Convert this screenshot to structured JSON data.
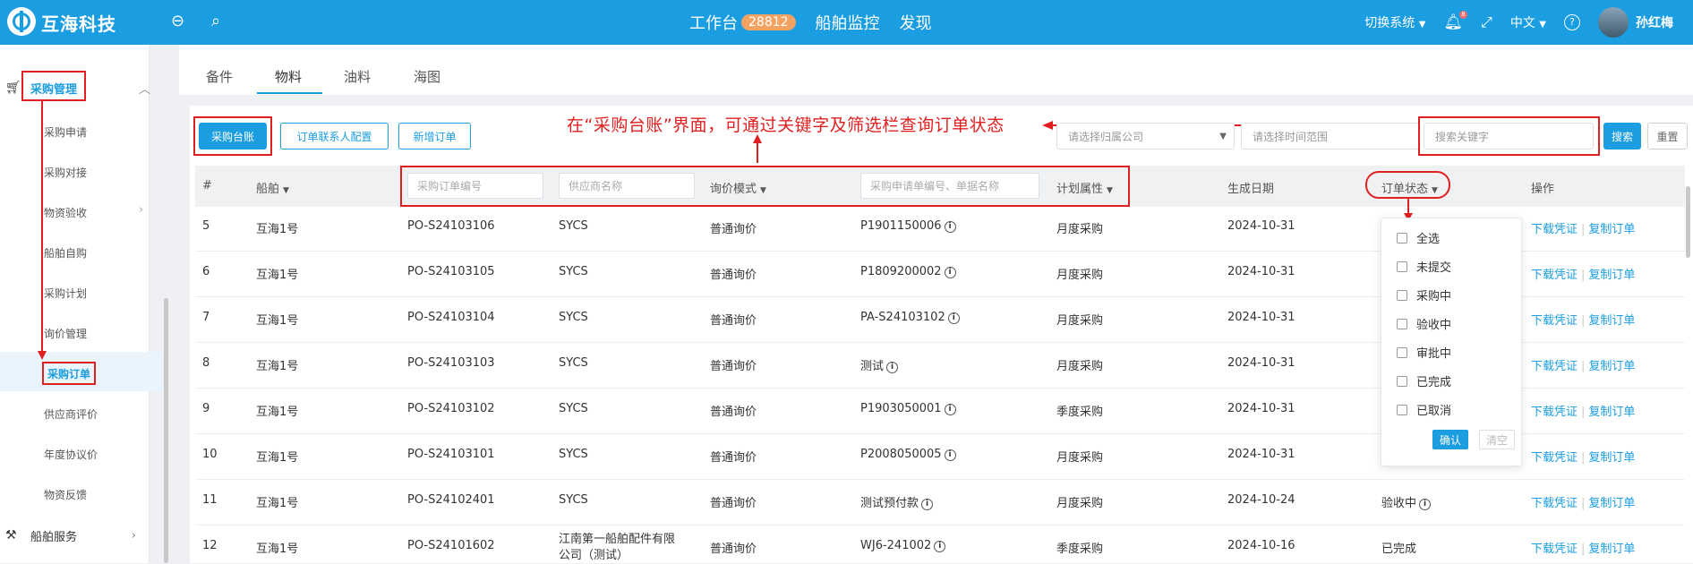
{
  "app": {
    "brand": "互海科技",
    "nav": {
      "workbench": "工作台",
      "workbench_count": "28812",
      "monitor": "船舶监控",
      "discover": "发现"
    },
    "right": {
      "switch_system": "切换系统",
      "notify_count": "8",
      "language": "中文",
      "user": "孙红梅"
    }
  },
  "sidebar": {
    "group_procurement": "采购管理",
    "items": [
      "采购申请",
      "采购对接",
      "物资验收",
      "船舶自购",
      "采购计划",
      "询价管理",
      "采购订单",
      "供应商评价",
      "年度协议价",
      "物资反馈"
    ],
    "group_service": "船舶服务"
  },
  "tabs": [
    "备件",
    "物料",
    "油料",
    "海图"
  ],
  "toolbar": {
    "ledger": "采购台账",
    "contact_config": "订单联系人配置",
    "new_order": "新增订单",
    "company_placeholder": "请选择归属公司",
    "time_placeholder": "请选择时间范围",
    "keyword_placeholder": "搜索关键字",
    "search": "搜索",
    "reset": "重置"
  },
  "annotation": "在“采购台账”界面，可通过关键字及筛选栏查询订单状态",
  "table": {
    "headers": {
      "index": "#",
      "ship": "船舶",
      "order_no_placeholder": "采购订单编号",
      "supplier_placeholder": "供应商名称",
      "inquiry_mode": "询价模式",
      "request_placeholder": "采购申请单编号、单据名称",
      "plan_attr": "计划属性",
      "created_date": "生成日期",
      "order_status": "订单状态",
      "actions": "操作"
    },
    "actions": {
      "download": "下载凭证",
      "copy": "复制订单"
    },
    "rows": [
      {
        "idx": "5",
        "ship": "互海1号",
        "order_no": "PO-S24103106",
        "supplier": "SYCS",
        "mode": "普通询价",
        "request": "P1901150006",
        "plan": "月度采购",
        "date": "2024-10-31",
        "status": ""
      },
      {
        "idx": "6",
        "ship": "互海1号",
        "order_no": "PO-S24103105",
        "supplier": "SYCS",
        "mode": "普通询价",
        "request": "P1809200002",
        "plan": "月度采购",
        "date": "2024-10-31",
        "status": ""
      },
      {
        "idx": "7",
        "ship": "互海1号",
        "order_no": "PO-S24103104",
        "supplier": "SYCS",
        "mode": "普通询价",
        "request": "PA-S24103102",
        "plan": "月度采购",
        "date": "2024-10-31",
        "status": ""
      },
      {
        "idx": "8",
        "ship": "互海1号",
        "order_no": "PO-S24103103",
        "supplier": "SYCS",
        "mode": "普通询价",
        "request": "测试",
        "plan": "月度采购",
        "date": "2024-10-31",
        "status": ""
      },
      {
        "idx": "9",
        "ship": "互海1号",
        "order_no": "PO-S24103102",
        "supplier": "SYCS",
        "mode": "普通询价",
        "request": "P1903050001",
        "plan": "季度采购",
        "date": "2024-10-31",
        "status": ""
      },
      {
        "idx": "10",
        "ship": "互海1号",
        "order_no": "PO-S24103101",
        "supplier": "SYCS",
        "mode": "普通询价",
        "request": "P2008050005",
        "plan": "月度采购",
        "date": "2024-10-31",
        "status": ""
      },
      {
        "idx": "11",
        "ship": "互海1号",
        "order_no": "PO-S24102401",
        "supplier": "SYCS",
        "mode": "普通询价",
        "request": "测试预付款",
        "plan": "月度采购",
        "date": "2024-10-24",
        "status": "验收中"
      },
      {
        "idx": "12",
        "ship": "互海1号",
        "order_no": "PO-S24101602",
        "supplier": "江南第一船舶配件有限公司（测试）",
        "supplier_line1": "江南第一船舶配件有限",
        "supplier_line2": "公司（测试）",
        "mode": "普通询价",
        "request": "WJ6-241002",
        "plan": "季度采购",
        "date": "2024-10-16",
        "status": "已完成"
      }
    ]
  },
  "status_filter": {
    "options": [
      "全选",
      "未提交",
      "采购中",
      "验收中",
      "审批中",
      "已完成",
      "已取消"
    ],
    "confirm": "确认",
    "clear": "清空"
  },
  "colors": {
    "primary": "#1a9de1",
    "annotation_red": "#e02020",
    "badge": "#f4a261"
  }
}
